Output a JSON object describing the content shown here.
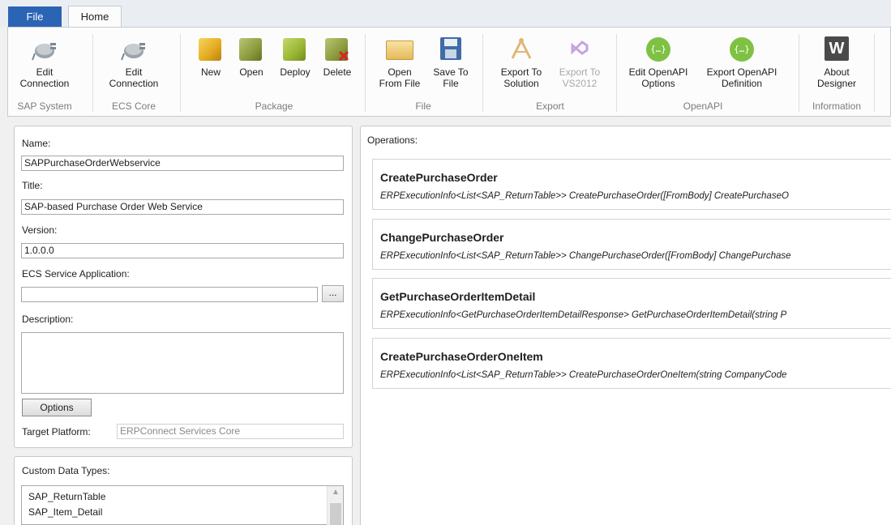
{
  "ribbon": {
    "tabs": [
      {
        "label": "File"
      },
      {
        "label": "Home"
      }
    ],
    "groups": [
      {
        "label": "SAP System",
        "buttons": [
          {
            "label": "Edit\nConnection",
            "icon": "plug-icon"
          }
        ]
      },
      {
        "label": "ECS Core",
        "buttons": [
          {
            "label": "Edit\nConnection",
            "icon": "plug-icon"
          }
        ]
      },
      {
        "label": "Package",
        "buttons": [
          {
            "label": "New",
            "icon": "package-new-icon"
          },
          {
            "label": "Open",
            "icon": "package-open-icon"
          },
          {
            "label": "Deploy",
            "icon": "package-deploy-icon"
          },
          {
            "label": "Delete",
            "icon": "package-delete-icon"
          }
        ]
      },
      {
        "label": "File",
        "buttons": [
          {
            "label": "Open\nFrom File",
            "icon": "folder-icon"
          },
          {
            "label": "Save To\nFile",
            "icon": "floppy-icon"
          }
        ]
      },
      {
        "label": "Export",
        "buttons": [
          {
            "label": "Export To\nSolution",
            "icon": "solution-icon"
          },
          {
            "label": "Export To\nVS2012",
            "icon": "visual-studio-icon",
            "disabled": true
          }
        ]
      },
      {
        "label": "OpenAPI",
        "buttons": [
          {
            "label": "Edit OpenAPI\nOptions",
            "icon": "openapi-icon"
          },
          {
            "label": "Export OpenAPI\nDefinition",
            "icon": "openapi-icon"
          }
        ]
      },
      {
        "label": "Information",
        "buttons": [
          {
            "label": "About\nDesigner",
            "icon": "w-logo-icon"
          }
        ]
      }
    ]
  },
  "properties": {
    "name_label": "Name:",
    "name_value": "SAPPurchaseOrderWebservice",
    "title_label": "Title:",
    "title_value": "SAP-based Purchase Order Web Service",
    "version_label": "Version:",
    "version_value": "1.0.0.0",
    "ecs_label": "ECS Service Application:",
    "ecs_value": "",
    "browse_label": "...",
    "description_label": "Description:",
    "description_value": "",
    "options_label": "Options",
    "target_platform_label": "Target Platform:",
    "target_platform_value": "ERPConnect Services Core"
  },
  "custom_types": {
    "label": "Custom Data Types:",
    "items": [
      "SAP_ReturnTable",
      "SAP_Item_Detail"
    ]
  },
  "operations": {
    "label": "Operations:",
    "items": [
      {
        "name": "CreatePurchaseOrder",
        "signature": "ERPExecutionInfo<List<SAP_ReturnTable>> CreatePurchaseOrder([FromBody] CreatePurchaseO"
      },
      {
        "name": "ChangePurchaseOrder",
        "signature": "ERPExecutionInfo<List<SAP_ReturnTable>> ChangePurchaseOrder([FromBody] ChangePurchase"
      },
      {
        "name": "GetPurchaseOrderItemDetail",
        "signature": "ERPExecutionInfo<GetPurchaseOrderItemDetailResponse> GetPurchaseOrderItemDetail(string P"
      },
      {
        "name": "CreatePurchaseOrderOneItem",
        "signature": "ERPExecutionInfo<List<SAP_ReturnTable>> CreatePurchaseOrderOneItem(string CompanyCode"
      }
    ]
  }
}
